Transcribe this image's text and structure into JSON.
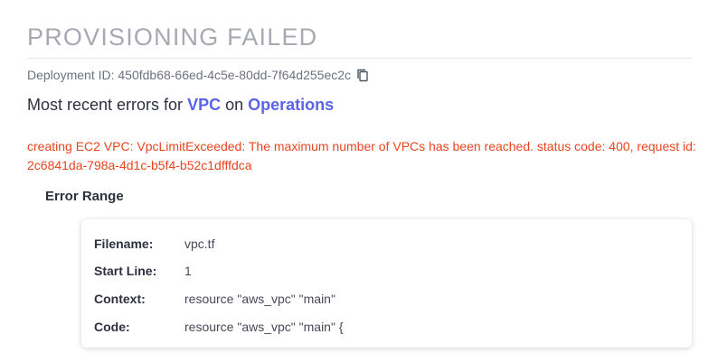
{
  "title": "PROVISIONING FAILED",
  "deployment": {
    "label": "Deployment ID:",
    "id": "450fdb68-66ed-4c5e-80dd-7f64d255ec2c"
  },
  "heading": {
    "prefix": "Most recent errors for",
    "resource": "VPC",
    "on": "on",
    "target": "Operations"
  },
  "error_message": "creating EC2 VPC: VpcLimitExceeded: The maximum number of VPCs has been reached. status code: 400, request id: 2c6841da-798a-4d1c-b5f4-b52c1dfffdca",
  "error_range": {
    "title": "Error Range",
    "rows": [
      {
        "label": "Filename:",
        "value": "vpc.tf"
      },
      {
        "label": "Start Line:",
        "value": "1"
      },
      {
        "label": "Context:",
        "value": "resource \"aws_vpc\" \"main\""
      },
      {
        "label": "Code:",
        "value": "resource \"aws_vpc\" \"main\" {"
      }
    ]
  },
  "colors": {
    "error": "#e8451f",
    "link": "#5b63e8"
  }
}
